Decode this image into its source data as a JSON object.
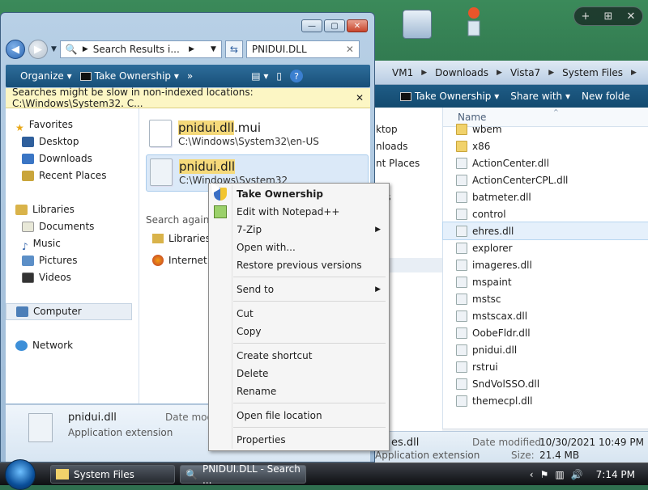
{
  "desktop": {
    "gadget_add": "+",
    "gadget_grid": "⊞",
    "gadget_close": "✕"
  },
  "back_window": {
    "breadcrumb": [
      "VM1",
      "Downloads",
      "Vista7",
      "System Files"
    ],
    "toolbar": {
      "take_ownership": "Take Ownership",
      "share_with": "Share with",
      "new_folder": "New folde"
    },
    "nav_items": [
      "ktop",
      "nloads",
      "nt Places",
      "nts"
    ],
    "column_name": "Name",
    "files": [
      {
        "name": "wbem",
        "type": "folder"
      },
      {
        "name": "x86",
        "type": "folder"
      },
      {
        "name": "ActionCenter.dll",
        "type": "dll"
      },
      {
        "name": "ActionCenterCPL.dll",
        "type": "dll"
      },
      {
        "name": "batmeter.dll",
        "type": "dll"
      },
      {
        "name": "control",
        "type": "exe"
      },
      {
        "name": "ehres.dll",
        "type": "dll",
        "selected": true
      },
      {
        "name": "explorer",
        "type": "exe"
      },
      {
        "name": "imageres.dll",
        "type": "dll"
      },
      {
        "name": "mspaint",
        "type": "exe"
      },
      {
        "name": "mstsc",
        "type": "exe"
      },
      {
        "name": "mstscax.dll",
        "type": "dll"
      },
      {
        "name": "OobeFldr.dll",
        "type": "dll"
      },
      {
        "name": "pnidui.dll",
        "type": "dll"
      },
      {
        "name": "rstrui",
        "type": "exe"
      },
      {
        "name": "SndVolSSO.dll",
        "type": "dll"
      },
      {
        "name": "themecpl.dll",
        "type": "dll"
      }
    ],
    "details": {
      "name": "es.dll",
      "type": "Application extension",
      "date_label": "Date modified:",
      "date_value": "10/30/2021 10:49 PM",
      "size_label": "Size:",
      "size_value": "21.4 MB"
    }
  },
  "front_window": {
    "address": "Search Results i...",
    "search_text": "PNIDUI.DLL",
    "toolbar": {
      "organize": "Organize",
      "take_ownership": "Take Ownership",
      "more": "»"
    },
    "info_bar": "Searches might be slow in non-indexed locations: C:\\Windows\\System32. C...",
    "nav": {
      "favorites": "Favorites",
      "desktop": "Desktop",
      "downloads": "Downloads",
      "recent": "Recent Places",
      "libraries": "Libraries",
      "documents": "Documents",
      "music": "Music",
      "pictures": "Pictures",
      "videos": "Videos",
      "computer": "Computer",
      "network": "Network"
    },
    "results": [
      {
        "highlight": "pnidui.dll",
        "suffix": ".mui",
        "path": "C:\\Windows\\System32\\en-US"
      },
      {
        "highlight": "pnidui.dll",
        "suffix": "",
        "path": "C:\\Windows\\System32"
      }
    ],
    "search_again": "Search again i",
    "search_again_items": [
      "Libraries",
      "Internet"
    ],
    "details": {
      "name": "pnidui.dll",
      "type": "Application extension",
      "date_label": "Date modi"
    }
  },
  "context_menu": {
    "take_ownership": "Take Ownership",
    "edit_notepad": "Edit with Notepad++",
    "seven_zip": "7-Zip",
    "open_with": "Open with...",
    "restore": "Restore previous versions",
    "send_to": "Send to",
    "cut": "Cut",
    "copy": "Copy",
    "create_shortcut": "Create shortcut",
    "delete": "Delete",
    "rename": "Rename",
    "open_location": "Open file location",
    "properties": "Properties"
  },
  "taskbar": {
    "items": [
      {
        "label": "System Files"
      },
      {
        "label": "PNIDUI.DLL - Search ..."
      }
    ],
    "time": "7:14 PM"
  }
}
